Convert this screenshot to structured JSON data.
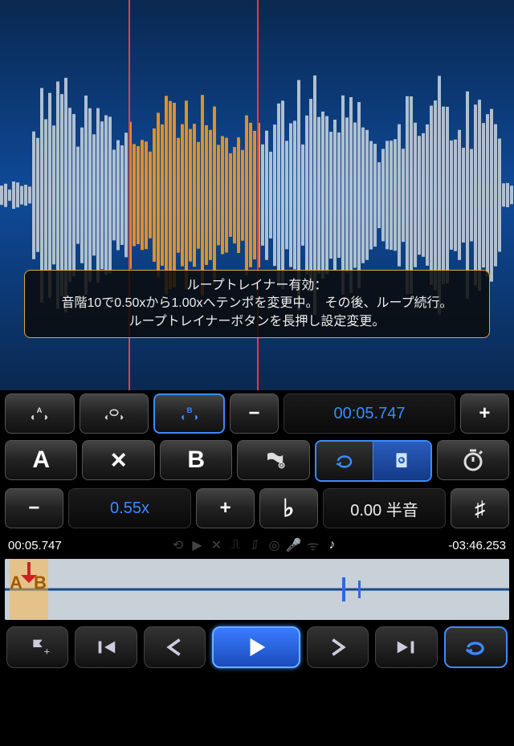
{
  "tooltip": {
    "line1": "ループトレイナー有効：",
    "line2": "音階10で0.50xから1.00xへテンポを変更中。　その後、ループ続行。",
    "line3": "ループトレイナーボタンを長押し設定変更。"
  },
  "loop": {
    "a_label": "A",
    "close_label": "×",
    "b_label": "B",
    "position_time": "00:05.747"
  },
  "speed": {
    "value": "0.55x"
  },
  "pitch": {
    "value": "0.00 半音",
    "flat": "♭",
    "sharp": "♯"
  },
  "time": {
    "elapsed": "00:05.747",
    "remaining": "-03:46.253"
  },
  "minimap": {
    "marker_a": "A",
    "marker_b": "B"
  },
  "icons": {
    "minus": "−",
    "plus": "+"
  },
  "colors": {
    "accent": "#3a8cff",
    "selection": "#e09028"
  }
}
